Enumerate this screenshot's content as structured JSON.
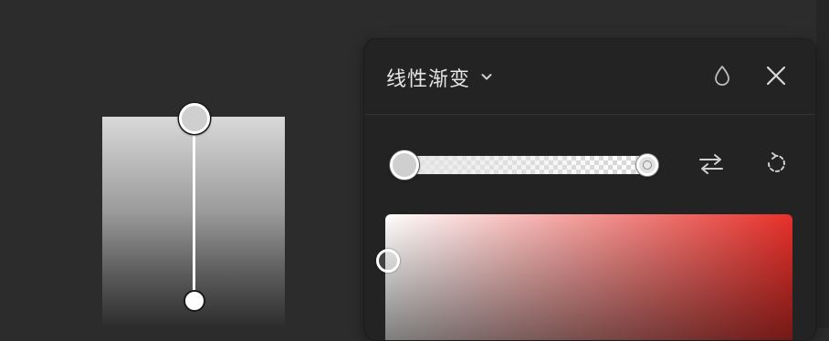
{
  "panel": {
    "title": "线性渐变"
  },
  "icons": {
    "title_dropdown": "chevron-down-icon",
    "opacity": "droplet-icon",
    "close": "close-icon",
    "swap_stops": "swap-arrows-icon",
    "rotate": "rotate-icon"
  },
  "gradient": {
    "stop_start_color": "#d9d9d9",
    "stop_end_color": "#2c2c2c"
  },
  "color_picker": {
    "hue_color": "#e8302a",
    "saturation": 0,
    "brightness": 1
  },
  "colors": {
    "background": "#2c2c2c",
    "panel": "#232323",
    "text": "#e6e6e6",
    "icon": "#cfcfcf"
  }
}
